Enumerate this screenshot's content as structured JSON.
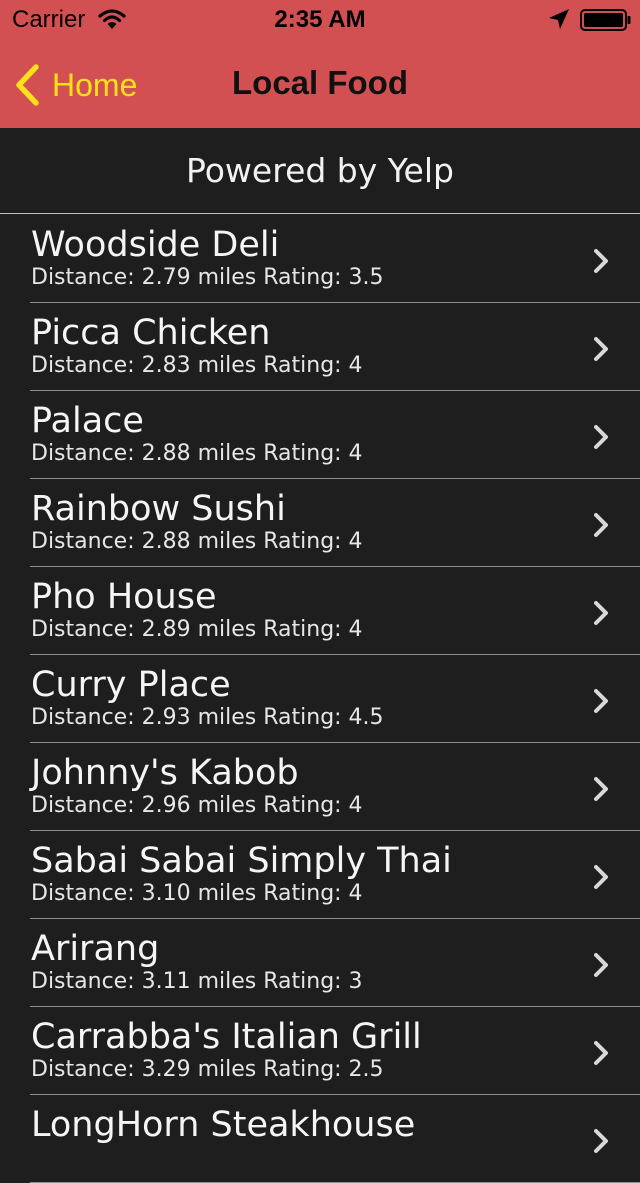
{
  "status_bar": {
    "carrier": "Carrier",
    "time": "2:35 AM",
    "icons": [
      "wifi-icon",
      "location-arrow-icon",
      "battery-icon"
    ]
  },
  "nav": {
    "back_label": "Home",
    "title": "Local Food",
    "back_icon": "chevron-left-icon"
  },
  "header_text": "Powered by Yelp",
  "colors": {
    "nav_bar": "#d35052",
    "back_accent": "#fde21b",
    "background": "#1e1e1e",
    "text": "#f5f5f5"
  },
  "restaurants": [
    {
      "name": "Woodside Deli",
      "detail": "Distance: 2.79 miles  Rating: 3.5"
    },
    {
      "name": "Picca Chicken",
      "detail": "Distance: 2.83 miles  Rating: 4"
    },
    {
      "name": "Palace",
      "detail": "Distance: 2.88 miles  Rating: 4"
    },
    {
      "name": "Rainbow Sushi",
      "detail": "Distance: 2.88 miles  Rating: 4"
    },
    {
      "name": "Pho House",
      "detail": "Distance: 2.89 miles  Rating: 4"
    },
    {
      "name": "Curry Place",
      "detail": "Distance: 2.93 miles  Rating: 4.5"
    },
    {
      "name": "Johnny's Kabob",
      "detail": "Distance: 2.96 miles  Rating: 4"
    },
    {
      "name": "Sabai Sabai Simply Thai",
      "detail": "Distance: 3.10 miles  Rating: 4"
    },
    {
      "name": "Arirang",
      "detail": "Distance: 3.11 miles  Rating: 3"
    },
    {
      "name": "Carrabba's Italian Grill",
      "detail": "Distance: 3.29 miles  Rating: 2.5"
    },
    {
      "name": "LongHorn Steakhouse",
      "detail": ""
    }
  ]
}
